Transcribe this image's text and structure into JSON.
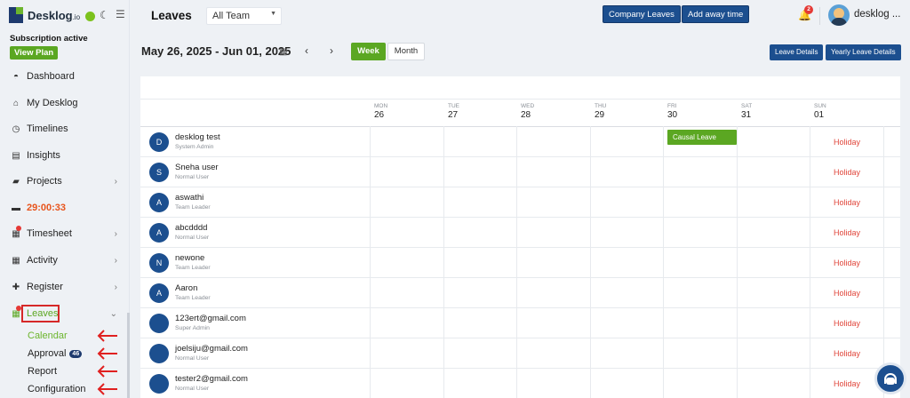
{
  "app": {
    "logo_text": "Desklog",
    "logo_suffix": ".io",
    "subscription_status": "Subscription active",
    "view_plan_label": "View Plan"
  },
  "sidebar": {
    "items": [
      {
        "label": "Dashboard",
        "icon": "dashboard-icon"
      },
      {
        "label": "My Desklog",
        "icon": "home-icon"
      },
      {
        "label": "Timelines",
        "icon": "clock-icon"
      },
      {
        "label": "Insights",
        "icon": "book-icon"
      },
      {
        "label": "Projects",
        "icon": "folder-icon"
      },
      {
        "label": "29:00:33",
        "icon": "timer-icon"
      },
      {
        "label": "Timesheet",
        "icon": "calendar-icon"
      },
      {
        "label": "Activity",
        "icon": "grid-icon"
      },
      {
        "label": "Register",
        "icon": "plus-icon"
      },
      {
        "label": "Leaves",
        "icon": "calendar-icon"
      }
    ],
    "leaves_sub": [
      {
        "label": "Calendar"
      },
      {
        "label": "Approval",
        "badge": "46"
      },
      {
        "label": "Report"
      },
      {
        "label": "Configuration"
      }
    ]
  },
  "header": {
    "title": "Leaves",
    "team_select_value": "All Team",
    "company_leaves_label": "Company Leaves",
    "add_away_time_label": "Add away time",
    "notification_count": "2",
    "username": "desklog ..."
  },
  "calendar": {
    "date_range": "May 26, 2025 - Jun 01, 2025",
    "view_week_label": "Week",
    "view_month_label": "Month",
    "leave_details_label": "Leave Details",
    "yearly_leave_details_label": "Yearly Leave Details",
    "days": [
      {
        "name": "MON",
        "date": "26"
      },
      {
        "name": "TUE",
        "date": "27"
      },
      {
        "name": "WED",
        "date": "28"
      },
      {
        "name": "THU",
        "date": "29"
      },
      {
        "name": "FRI",
        "date": "30"
      },
      {
        "name": "SAT",
        "date": "31"
      },
      {
        "name": "SUN",
        "date": "01"
      }
    ],
    "users": [
      {
        "initial": "D",
        "name": "desklog test",
        "role": "System Admin"
      },
      {
        "initial": "S",
        "name": "Sneha user",
        "role": "Normal User"
      },
      {
        "initial": "A",
        "name": "aswathi",
        "role": "Team Leader"
      },
      {
        "initial": "A",
        "name": "abcdddd",
        "role": "Normal User"
      },
      {
        "initial": "N",
        "name": "newone",
        "role": "Team Leader"
      },
      {
        "initial": "A",
        "name": "Aaron",
        "role": "Team Leader"
      },
      {
        "initial": "",
        "name": "123ert@gmail.com",
        "role": "Super Admin"
      },
      {
        "initial": "",
        "name": "joelsiju@gmail.com",
        "role": "Normal User"
      },
      {
        "initial": "",
        "name": "tester2@gmail.com",
        "role": "Normal User"
      }
    ],
    "holiday_label": "Holiday",
    "leave_entry_label": "Causal Leave"
  },
  "colors": {
    "primary": "#1c4f8f",
    "accent_green": "#5ba722",
    "holiday_red": "#e0453a",
    "highlight_red": "#d62828"
  }
}
